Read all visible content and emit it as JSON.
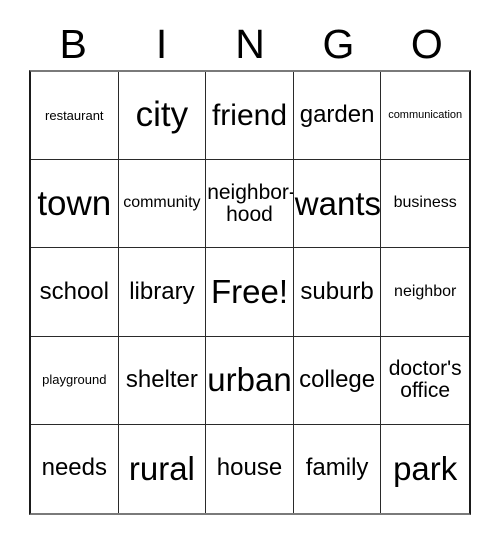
{
  "card": {
    "title": "BINGO",
    "header_letters": [
      "B",
      "I",
      "N",
      "G",
      "O"
    ],
    "free_space_label": "Free!",
    "grid_size": "5x5",
    "colors": {
      "background": "#ffffff",
      "text": "#000000",
      "grid_line": "#2a2a2a",
      "outer_border": "#1b1b1b"
    },
    "rows": [
      {
        "cells": [
          {
            "text": "restaurant",
            "size": "xs"
          },
          {
            "text": "city",
            "size": "xxxl"
          },
          {
            "text": "friend",
            "size": "xl"
          },
          {
            "text": "garden",
            "size": "ml"
          },
          {
            "text": "communication",
            "size": "xxs"
          }
        ]
      },
      {
        "cells": [
          {
            "text": "town",
            "size": "xxxl"
          },
          {
            "text": "community",
            "size": "s"
          },
          {
            "text": "neighbor-\nhood",
            "size": "m"
          },
          {
            "text": "wants",
            "size": "xxl"
          },
          {
            "text": "business",
            "size": "s"
          }
        ]
      },
      {
        "cells": [
          {
            "text": "school",
            "size": "ml"
          },
          {
            "text": "library",
            "size": "ml"
          },
          {
            "text": "Free!",
            "size": "xxl"
          },
          {
            "text": "suburb",
            "size": "ml"
          },
          {
            "text": "neighbor",
            "size": "s"
          }
        ]
      },
      {
        "cells": [
          {
            "text": "playground",
            "size": "xs"
          },
          {
            "text": "shelter",
            "size": "ml"
          },
          {
            "text": "urban",
            "size": "xxl"
          },
          {
            "text": "college",
            "size": "ml"
          },
          {
            "text": "doctor's\noffice",
            "size": "m"
          }
        ]
      },
      {
        "cells": [
          {
            "text": "needs",
            "size": "ml"
          },
          {
            "text": "rural",
            "size": "xxl"
          },
          {
            "text": "house",
            "size": "ml"
          },
          {
            "text": "family",
            "size": "ml"
          },
          {
            "text": "park",
            "size": "xxl"
          }
        ]
      }
    ]
  }
}
